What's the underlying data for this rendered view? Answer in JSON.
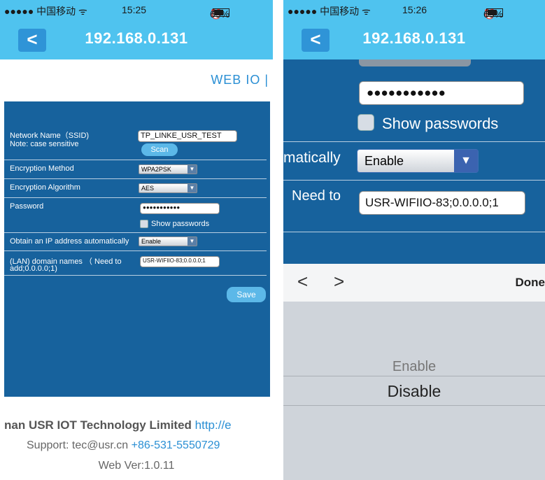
{
  "left": {
    "status": {
      "carrier": "●●●●● 中国移动 ᯤ",
      "time": "15:25",
      "battery": "65%"
    },
    "nav": {
      "back_label": "<",
      "title": "192.168.0.131"
    },
    "header_link": "WEB IO |",
    "form": {
      "ssid_label": "Network Name（SSID)",
      "ssid_note": "Note: case sensitive",
      "ssid_value": "TP_LINKE_USR_TEST",
      "scan_label": "Scan",
      "enc_method_label": "Encryption Method",
      "enc_method_value": "WPA2PSK",
      "enc_alg_label": "Encryption Algorithm",
      "enc_alg_value": "AES",
      "password_label": "Password",
      "password_value": "●●●●●●●●●●●",
      "show_passwords_label": "Show passwords",
      "dhcp_label": "Obtain an IP address automatically",
      "dhcp_value": "Enable",
      "domain_label_1": "(LAN)  domain  names  （ Need  to",
      "domain_label_2": "add;0.0.0.0;1)",
      "domain_value": "USR-WIFIIO-83;0.0.0.0;1",
      "save_label": "Save"
    },
    "footer": {
      "company": "nan USR IOT Technology Limited",
      "company_link": "http://e",
      "support_prefix": "Support: tec@usr.cn",
      "support_phone": "+86-531-5550729",
      "version": "Web Ver:1.0.11"
    }
  },
  "right": {
    "status": {
      "carrier": "●●●●● 中国移动 ᯤ",
      "time": "15:26",
      "battery": "65%"
    },
    "nav": {
      "back_label": "<",
      "title": "192.168.0.131"
    },
    "form": {
      "password_value": "●●●●●●●●●●●",
      "show_passwords_label": "Show passwords",
      "dhcp_label_fragment": "matically",
      "dhcp_value": "Enable",
      "domain_label_fragment": "Need   to",
      "domain_value": "USR-WIFIIO-83;0.0.0.0;1"
    },
    "keyboard_bar": {
      "prev_label": "<",
      "next_label": ">",
      "done_label": "Done"
    },
    "picker": {
      "options": [
        "Enable",
        "Disable"
      ],
      "selected": "Disable"
    }
  },
  "colors": {
    "nav_blue": "#4fc3ef",
    "form_blue": "#17629d",
    "link_blue": "#2a8fd4"
  }
}
